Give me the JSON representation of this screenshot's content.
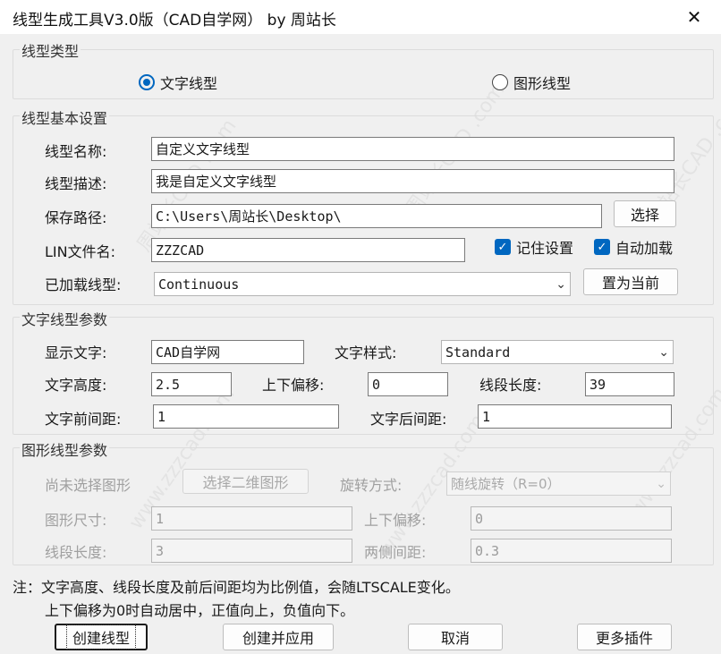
{
  "window": {
    "title": "线型生成工具V3.0版（CAD自学网） by 周站长",
    "close_glyph": "✕"
  },
  "type_group": {
    "title": "线型类型",
    "options": [
      "文字线型",
      "图形线型"
    ],
    "selected": "文字线型"
  },
  "basic_group": {
    "title": "线型基本设置",
    "name_label": "线型名称:",
    "name_value": "自定义文字线型",
    "desc_label": "线型描述:",
    "desc_value": "我是自定义文字线型",
    "path_label": "保存路径:",
    "path_value": "C:\\Users\\周站长\\Desktop\\",
    "choose_button": "选择",
    "lin_label": "LIN文件名:",
    "lin_value": "ZZZCAD",
    "remember_label": "记住设置",
    "remember_checked": true,
    "autoload_label": "自动加载",
    "autoload_checked": true,
    "loaded_label": "已加载线型:",
    "loaded_value": "Continuous",
    "set_current_button": "置为当前"
  },
  "text_group": {
    "title": "文字线型参数",
    "display_label": "显示文字:",
    "display_value": "CAD自学网",
    "style_label": "文字样式:",
    "style_value": "Standard",
    "height_label": "文字高度:",
    "height_value": "2.5",
    "offset_label": "上下偏移:",
    "offset_value": "0",
    "seg_label": "线段长度:",
    "seg_value": "39",
    "front_label": "文字前间距:",
    "front_value": "1",
    "back_label": "文字后间距:",
    "back_value": "1"
  },
  "shape_group": {
    "title": "图形线型参数",
    "status_label": "尚未选择图形",
    "choose_2d_button": "选择二维图形",
    "rotation_label": "旋转方式:",
    "rotation_value": "随线旋转（R=0）",
    "size_label": "图形尺寸:",
    "size_value": "1",
    "offset_label": "上下偏移:",
    "offset_value": "0",
    "seg_label": "线段长度:",
    "seg_value": "3",
    "gap_label": "两侧间距:",
    "gap_value": "0.3"
  },
  "notes": {
    "line1": "注：文字高度、线段长度及前后间距均为比例值，会随LTSCALE变化。",
    "line2": "上下偏移为0时自动居中，正值向上，负值向下。"
  },
  "buttons": {
    "create": "创建线型",
    "create_apply": "创建并应用",
    "cancel": "取消",
    "more_plugins": "更多插件"
  },
  "watermark": {
    "text": "周站长CAD .com",
    "text2": "www.zzzcad.com"
  },
  "colors": {
    "accent": "#0067c0",
    "background": "#f0f0f0",
    "disabled_text": "#a0a0a0"
  }
}
